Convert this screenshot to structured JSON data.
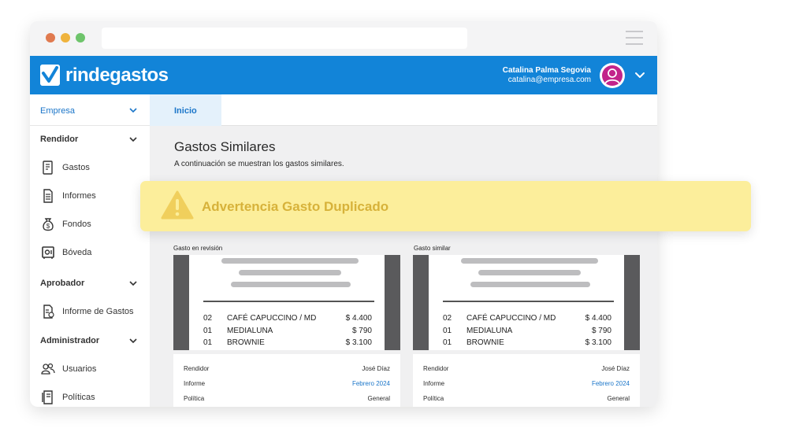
{
  "header": {
    "brand": "rindegastos",
    "user_name": "Catalina Palma Segovia",
    "user_email": "catalina@empresa.com"
  },
  "sidebar": {
    "company": "Empresa",
    "sections": [
      {
        "title": "Rendidor",
        "items": [
          {
            "label": "Gastos",
            "icon": "receipt-icon"
          },
          {
            "label": "Informes",
            "icon": "document-icon"
          },
          {
            "label": "Fondos",
            "icon": "money-bag-icon"
          },
          {
            "label": "Bóveda",
            "icon": "safe-icon"
          }
        ]
      },
      {
        "title": "Aprobador",
        "items": [
          {
            "label": "Informe de Gastos",
            "icon": "report-icon"
          }
        ]
      },
      {
        "title": "Administrador",
        "items": [
          {
            "label": "Usuarios",
            "icon": "users-icon"
          },
          {
            "label": "Políticas",
            "icon": "policy-icon"
          }
        ]
      }
    ]
  },
  "tabs": {
    "home": "Inicio"
  },
  "main": {
    "title": "Gastos Similares",
    "subtitle": "A continuación se muestran los gastos similares."
  },
  "warning": {
    "text": "Advertencia Gasto Duplicado",
    "icon": "warning-triangle-icon"
  },
  "comparison": [
    {
      "label": "Gasto en revisión",
      "lines": [
        {
          "qty": "02",
          "desc": "CAFÉ CAPUCCINO / MD",
          "price": "$ 4.400"
        },
        {
          "qty": "01",
          "desc": "MEDIALUNA",
          "price": "$ 790"
        },
        {
          "qty": "01",
          "desc": "BROWNIE",
          "price": "$ 3.100"
        }
      ],
      "meta": [
        {
          "key": "Rendidor",
          "value": "José Díaz"
        },
        {
          "key": "Informe",
          "value": "Febrero 2024"
        },
        {
          "key": "Política",
          "value": "General"
        }
      ]
    },
    {
      "label": "Gasto similar",
      "lines": [
        {
          "qty": "02",
          "desc": "CAFÉ CAPUCCINO / MD",
          "price": "$ 4.400"
        },
        {
          "qty": "01",
          "desc": "MEDIALUNA",
          "price": "$ 790"
        },
        {
          "qty": "01",
          "desc": "BROWNIE",
          "price": "$ 3.100"
        }
      ],
      "meta": [
        {
          "key": "Rendidor",
          "value": "José Díaz"
        },
        {
          "key": "Informe",
          "value": "Febrero 2024"
        },
        {
          "key": "Política",
          "value": "General"
        }
      ]
    }
  ],
  "colors": {
    "brand_blue": "#1284d8",
    "warning_bg": "#fcee9b",
    "warning_text": "#d7b23a",
    "avatar": "#c2248b"
  }
}
